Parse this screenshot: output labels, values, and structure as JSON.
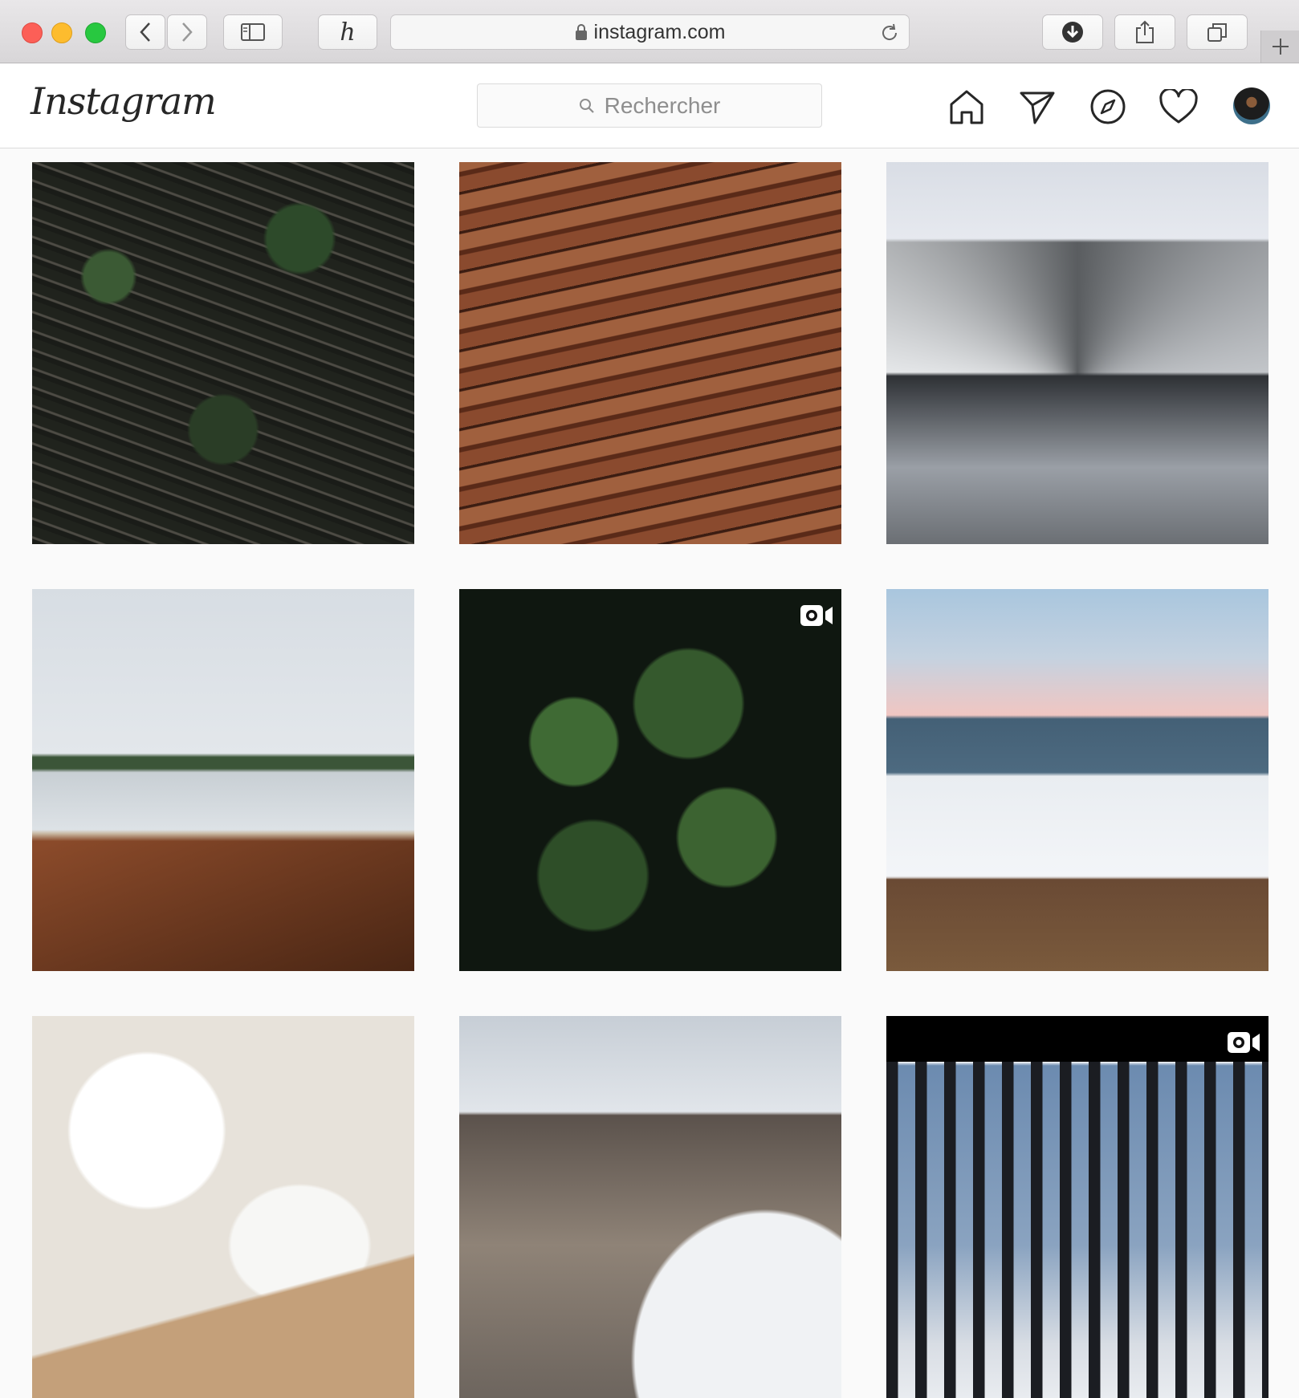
{
  "browser": {
    "url": "instagram.com"
  },
  "instagram": {
    "logo": "Instagram",
    "search_placeholder": "Rechercher",
    "nav": [
      "home-icon",
      "direct-icon",
      "explore-icon",
      "activity-icon",
      "avatar"
    ]
  },
  "grid": [
    {
      "name": "post-1",
      "video": false
    },
    {
      "name": "post-2",
      "video": false
    },
    {
      "name": "post-3",
      "video": false
    },
    {
      "name": "post-4",
      "video": false
    },
    {
      "name": "post-5",
      "video": true
    },
    {
      "name": "post-6",
      "video": false
    },
    {
      "name": "post-7",
      "video": false
    },
    {
      "name": "post-8",
      "video": false
    },
    {
      "name": "post-9",
      "video": true
    }
  ]
}
